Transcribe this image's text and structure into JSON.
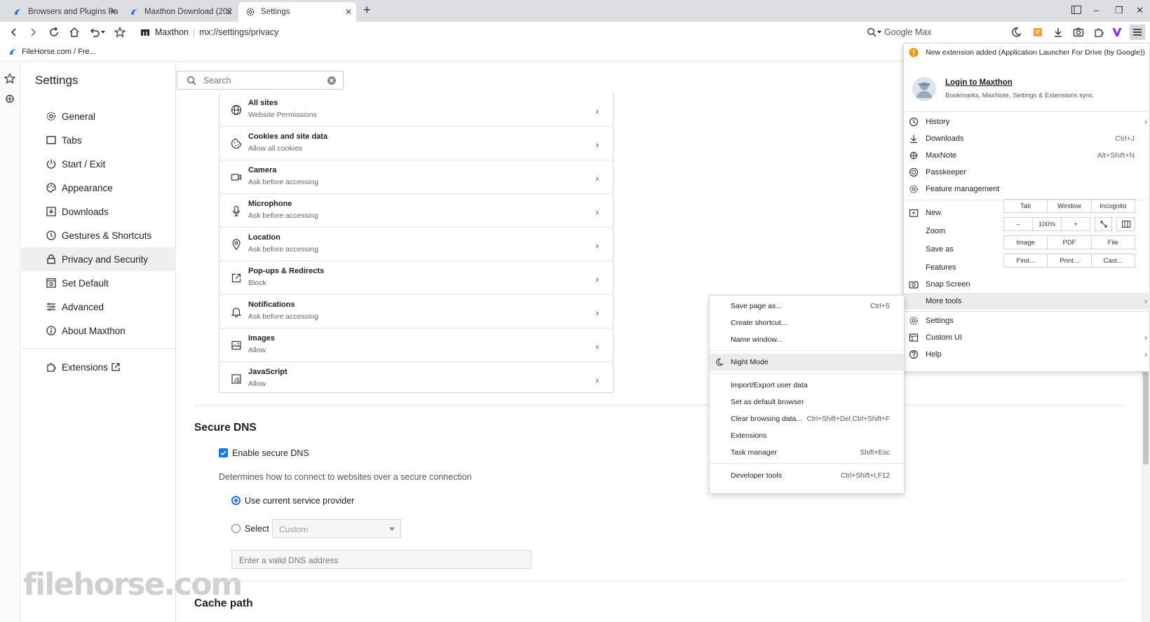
{
  "tabs": [
    {
      "title": "Browsers and Plugins Pa",
      "close": "✕"
    },
    {
      "title": "Maxthon Download (202",
      "close": "✕"
    },
    {
      "title": "Settings",
      "close": "✕"
    }
  ],
  "window_controls": {
    "new_tab": "+",
    "minimize": "–",
    "restore": "❐",
    "close": "✕"
  },
  "address": {
    "brand": "Maxthon",
    "url": "mx://settings/privacy"
  },
  "search_engine": {
    "placeholder": "Google Max"
  },
  "bookmarks": [
    {
      "label": "FileHorse.com / Fre..."
    }
  ],
  "settings": {
    "title": "Settings",
    "search_placeholder": "Search",
    "nav": [
      {
        "label": "General",
        "icon": "gear-icon"
      },
      {
        "label": "Tabs",
        "icon": "tab-icon"
      },
      {
        "label": "Start / Exit",
        "icon": "power-icon"
      },
      {
        "label": "Appearance",
        "icon": "palette-icon"
      },
      {
        "label": "Downloads",
        "icon": "download-icon"
      },
      {
        "label": "Gestures & Shortcuts",
        "icon": "clock-icon"
      },
      {
        "label": "Privacy and Security",
        "icon": "lock-icon"
      },
      {
        "label": "Set Default",
        "icon": "browser-icon"
      },
      {
        "label": "Advanced",
        "icon": "sliders-icon"
      },
      {
        "label": "About Maxthon",
        "icon": "info-icon"
      }
    ],
    "extensions_label": "Extensions",
    "selected": "Privacy and Security"
  },
  "permissions": [
    {
      "title": "All sites",
      "subtitle": "Website Permissions",
      "icon": "globe-icon"
    },
    {
      "title": "Cookies and site data",
      "subtitle": "Allow all cookies",
      "icon": "cookie-icon"
    },
    {
      "title": "Camera",
      "subtitle": "Ask before accessing",
      "icon": "camera-icon"
    },
    {
      "title": "Microphone",
      "subtitle": "Ask before accessing",
      "icon": "microphone-icon"
    },
    {
      "title": "Location",
      "subtitle": "Ask before accessing",
      "icon": "location-icon"
    },
    {
      "title": "Pop-ups & Redirects",
      "subtitle": "Block",
      "icon": "popup-icon"
    },
    {
      "title": "Notifications",
      "subtitle": "Ask before accessing",
      "icon": "bell-icon"
    },
    {
      "title": "Images",
      "subtitle": "Allow",
      "icon": "image-icon"
    },
    {
      "title": "JavaScript",
      "subtitle": "Allow",
      "icon": "code-icon"
    }
  ],
  "secure_dns": {
    "heading": "Secure DNS",
    "enable_label": "Enable secure DNS",
    "enabled": true,
    "description": "Determines how to connect to websites over a secure connection",
    "option_current": "Use current service provider",
    "option_select": "Select",
    "select_value": "Custom",
    "dns_placeholder": "Enter a valid DNS address"
  },
  "cache_path": {
    "heading": "Cache path"
  },
  "menu": {
    "notice": "New extension added (Application Launcher For Drive (by Google))",
    "login_title": "Login to Maxthon",
    "login_subtitle": "Bookmarks, MaxNote, Settings & Extensions sync",
    "items_top": [
      {
        "label": "History",
        "shortcut": "",
        "arrow": "›"
      },
      {
        "label": "Downloads",
        "shortcut": "Ctrl+J",
        "arrow": ""
      },
      {
        "label": "MaxNote",
        "shortcut": "Alt+Shift+N",
        "arrow": ""
      },
      {
        "label": "Passkeeper",
        "shortcut": "",
        "arrow": ""
      },
      {
        "label": "Feature management",
        "shortcut": "",
        "arrow": ""
      }
    ],
    "new_label": "New",
    "new_options": [
      "Tab",
      "Window",
      "Incognito"
    ],
    "zoom_label": "Zoom",
    "zoom_minus": "–",
    "zoom_value": "100%",
    "zoom_plus": "+",
    "saveas_label": "Save as",
    "saveas_options": [
      "Image",
      "PDF",
      "File"
    ],
    "features_label": "Features",
    "features_options": [
      "Find...",
      "Print...",
      "Cast..."
    ],
    "items_bottom": [
      {
        "label": "Snap Screen",
        "arrow": ""
      },
      {
        "label": "More tools",
        "arrow": "›"
      },
      {
        "label": "Settings",
        "arrow": ""
      },
      {
        "label": "Custom UI",
        "arrow": "›"
      },
      {
        "label": "Help",
        "arrow": "›"
      }
    ]
  },
  "submenu": [
    {
      "label": "Save page as...",
      "shortcut": "Ctrl+S"
    },
    {
      "label": "Create shortcut...",
      "shortcut": ""
    },
    {
      "label": "Name window...",
      "shortcut": ""
    },
    {
      "label": "Night Mode",
      "shortcut": ""
    },
    {
      "label": "Import/Export user data",
      "shortcut": ""
    },
    {
      "label": "Set as default browser",
      "shortcut": ""
    },
    {
      "label": "Clear browsing data...",
      "shortcut": "Ctrl+Shift+Del,Ctrl+Shift+F"
    },
    {
      "label": "Extensions",
      "shortcut": ""
    },
    {
      "label": "Task manager",
      "shortcut": "Shift+Esc"
    },
    {
      "label": "Developer tools",
      "shortcut": "Ctrl+Shift+I,F12"
    }
  ],
  "watermark": "filehorse.com",
  "colors": {
    "accent": "#1a73e8",
    "selected_nav": "#eeeff0",
    "maxthon_purple": "#8a2be2"
  }
}
